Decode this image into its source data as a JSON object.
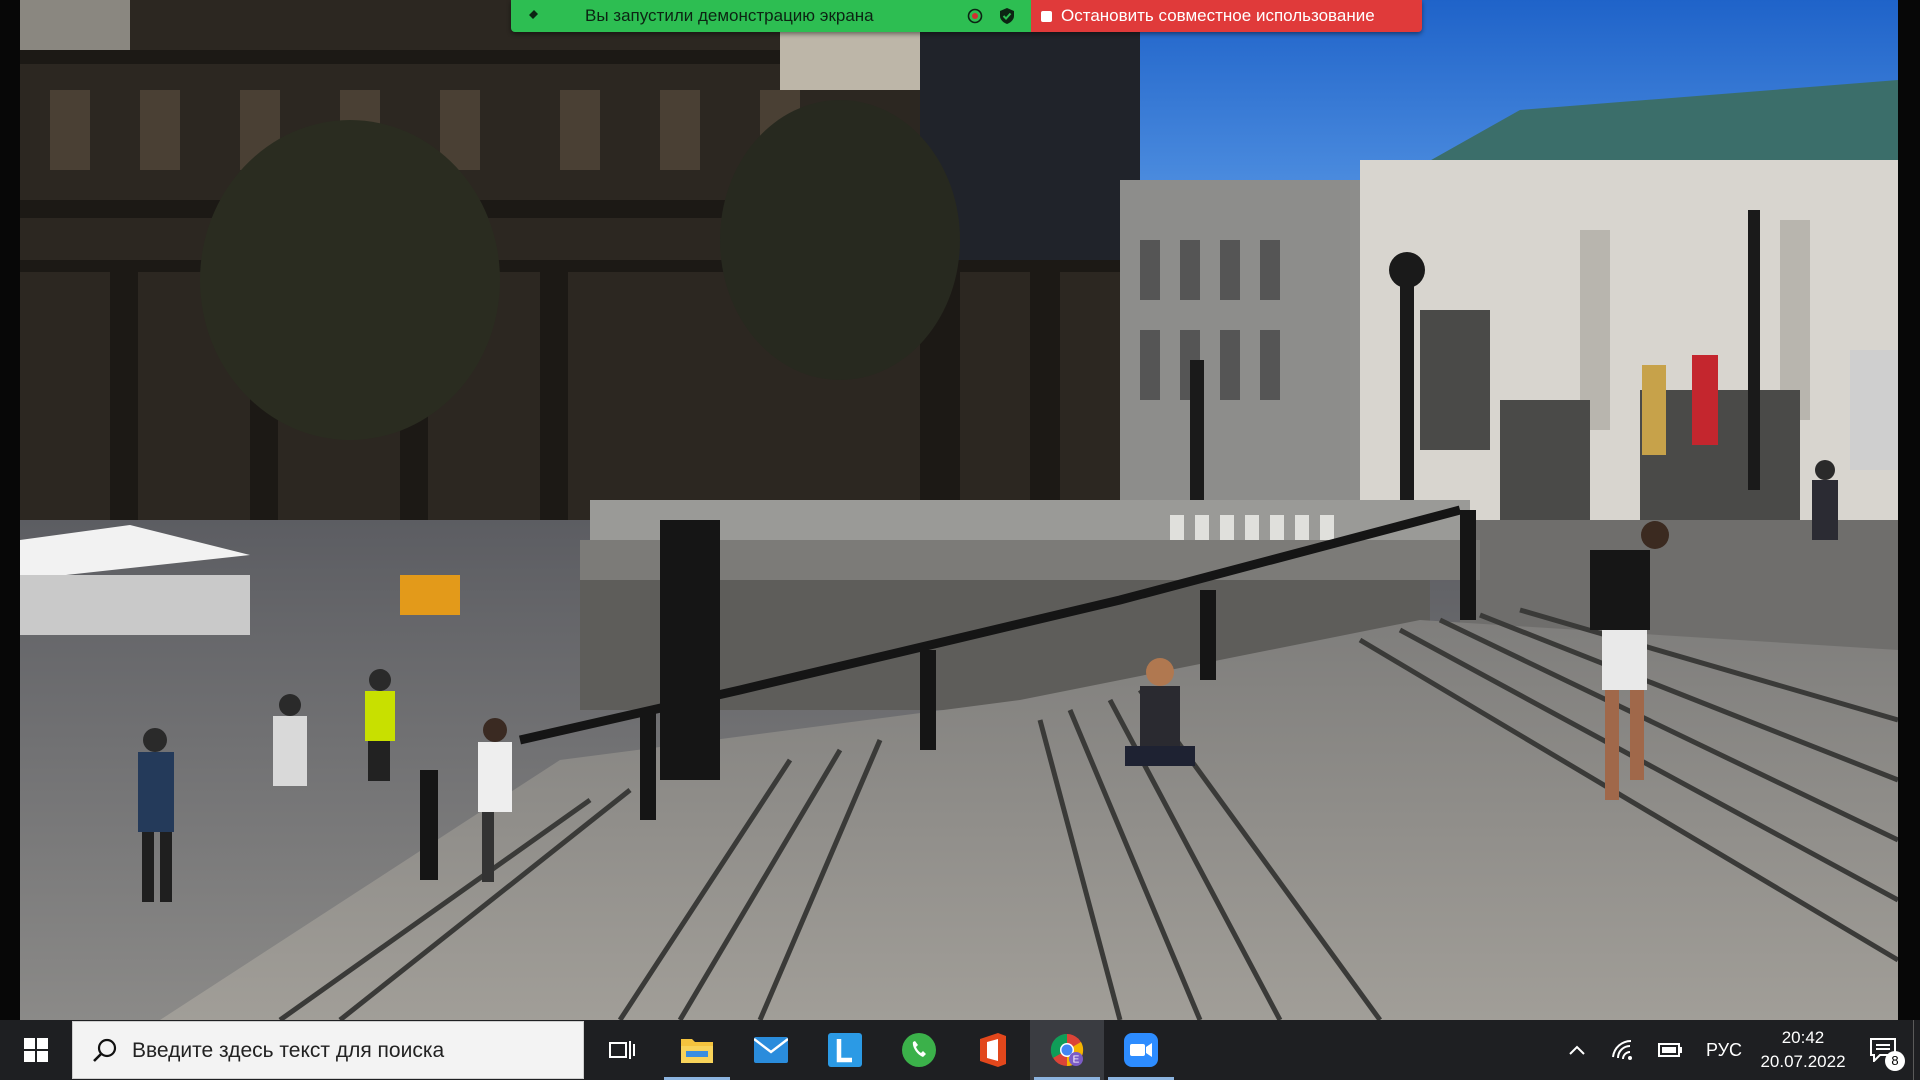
{
  "share_bar": {
    "status_text": "Вы запустили демонстрацию экрана",
    "stop_label": "Остановить совместное использование",
    "status_color": "#2dbe52",
    "stop_color": "#e03a3a"
  },
  "taskbar": {
    "search_placeholder": "Введите здесь текст для поиска",
    "apps": [
      {
        "name": "file-explorer",
        "icon": "folder-icon",
        "running": true
      },
      {
        "name": "mail",
        "icon": "mail-icon",
        "running": false
      },
      {
        "name": "l-app",
        "icon": "l-letter-icon",
        "running": false
      },
      {
        "name": "phone",
        "icon": "phone-icon",
        "running": false
      },
      {
        "name": "office",
        "icon": "office-icon",
        "running": false
      },
      {
        "name": "chrome",
        "icon": "chrome-icon",
        "running": true,
        "badge": "E"
      },
      {
        "name": "zoom",
        "icon": "zoom-camera-icon",
        "running": true
      }
    ],
    "tray": {
      "language": "РУС",
      "time": "20:42",
      "date": "20.07.2022",
      "notification_count": "8"
    }
  }
}
